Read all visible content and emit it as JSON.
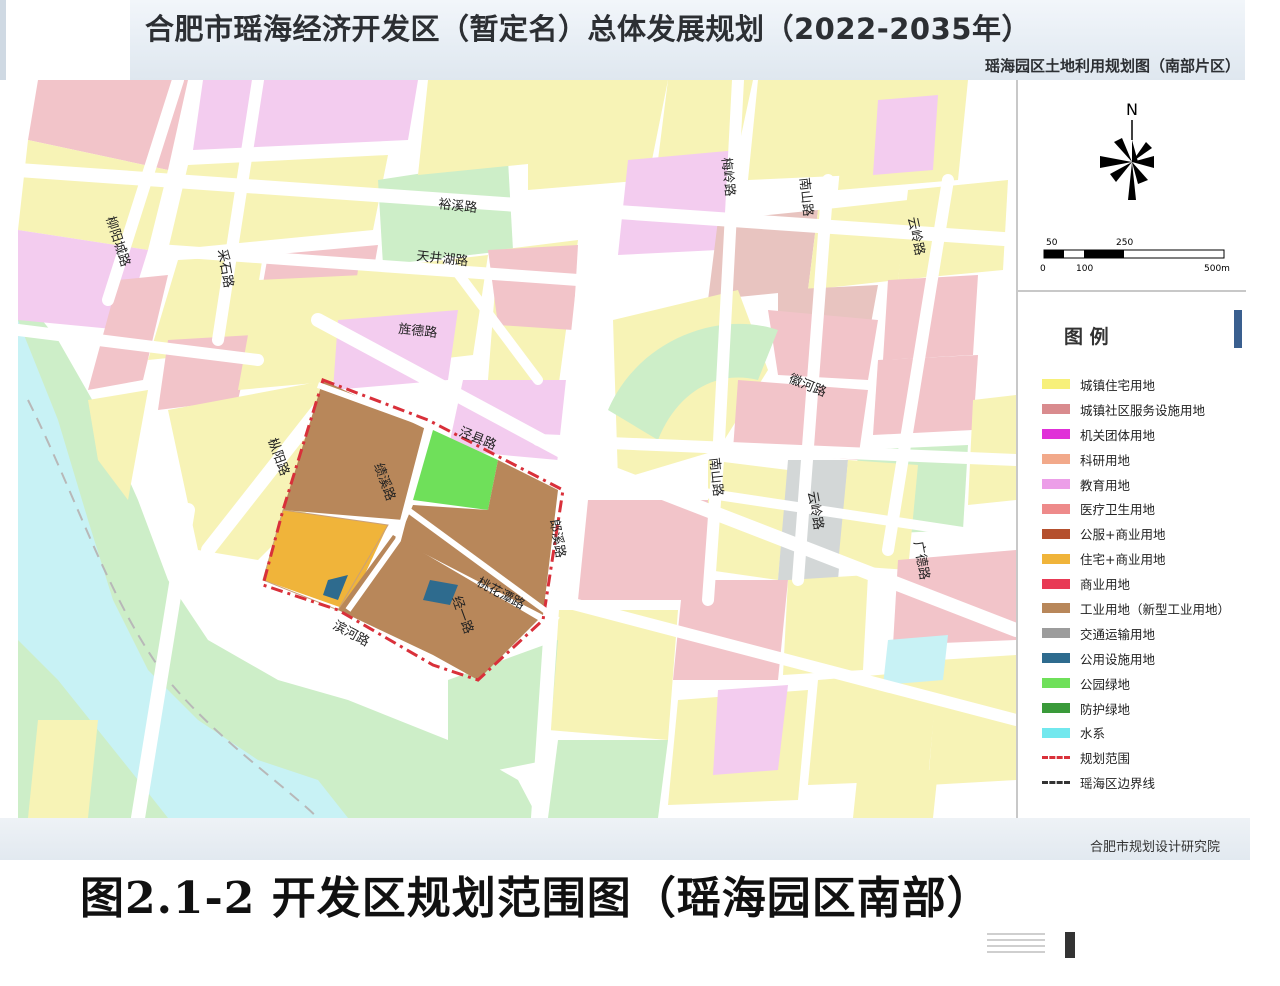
{
  "header": {
    "plan_title": "合肥市瑶海经济开发区（暂定名）总体发展规划（2022-2035年）",
    "sheet_title": "瑶海园区土地利用规划图（南部片区）"
  },
  "compass": {
    "label": "N"
  },
  "scale_bar": {
    "ticks_top": [
      "50",
      "250"
    ],
    "ticks_bottom": [
      "0",
      "100",
      "500m"
    ]
  },
  "roads": {
    "yuxi": "裕溪路",
    "tianjinghu": "天井湖路",
    "liuyang_n": "柳阳城路",
    "caishi": "采石路",
    "jingde": "旌德路",
    "jingxian": "泾县路",
    "liuyang": "枞阳路",
    "jixi": "绩溪路",
    "langxi": "郎溪路",
    "taohuatan": "桃花潭路",
    "binhe": "滨河路",
    "jingyi": "经一路",
    "meiling": "梅岭路",
    "nanshan_n": "南山路",
    "yunling_n": "云岭路",
    "huihe": "徽河路",
    "nanshan": "南山路",
    "yunling": "云岭路",
    "guangde": "广德路"
  },
  "legend": {
    "title": "图 例",
    "items": [
      {
        "label": "城镇住宅用地",
        "color": "#f7f07a",
        "style": "fill"
      },
      {
        "label": "城镇社区服务设施用地",
        "color": "#d98b8e",
        "style": "fill"
      },
      {
        "label": "机关团体用地",
        "color": "#e030d8",
        "style": "fill"
      },
      {
        "label": "科研用地",
        "color": "#f2a98a",
        "style": "fill"
      },
      {
        "label": "教育用地",
        "color": "#ec9ee8",
        "style": "fill"
      },
      {
        "label": "医疗卫生用地",
        "color": "#ee8a8a",
        "style": "fill"
      },
      {
        "label": "公服+商业用地",
        "color": "#b5502e",
        "style": "fill"
      },
      {
        "label": "住宅+商业用地",
        "color": "#f0b43a",
        "style": "fill"
      },
      {
        "label": "商业用地",
        "color": "#e83a55",
        "style": "fill"
      },
      {
        "label": "工业用地（新型工业用地）",
        "color": "#b8875a",
        "style": "fill"
      },
      {
        "label": "交通运输用地",
        "color": "#9c9c9c",
        "style": "fill"
      },
      {
        "label": "公用设施用地",
        "color": "#2e6b8e",
        "style": "fill"
      },
      {
        "label": "公园绿地",
        "color": "#6fe05a",
        "style": "fill"
      },
      {
        "label": "防护绿地",
        "color": "#3a9a3a",
        "style": "fill"
      },
      {
        "label": "水系",
        "color": "#72e8ee",
        "style": "fill"
      },
      {
        "label": "规划范围",
        "color": "#d9303a",
        "style": "dashdot"
      },
      {
        "label": "瑶海区边界线",
        "color": "#333333",
        "style": "dash"
      }
    ]
  },
  "footer": {
    "credit": "合肥市规划设计研究院",
    "caption": "图2.1-2 开发区规划范围图（瑶海园区南部）"
  },
  "colors": {
    "residential": "#f7f3b6",
    "community": "#f2c4c9",
    "education": "#f3ccef",
    "green": "#cdeec8",
    "water": "#c8f2f5",
    "road": "#ffffff",
    "industrial": "#b8875a",
    "mixed_res": "#f0b43a",
    "park": "#6fe05a",
    "utility": "#2e6b8e",
    "boundary": "#d9303a"
  }
}
